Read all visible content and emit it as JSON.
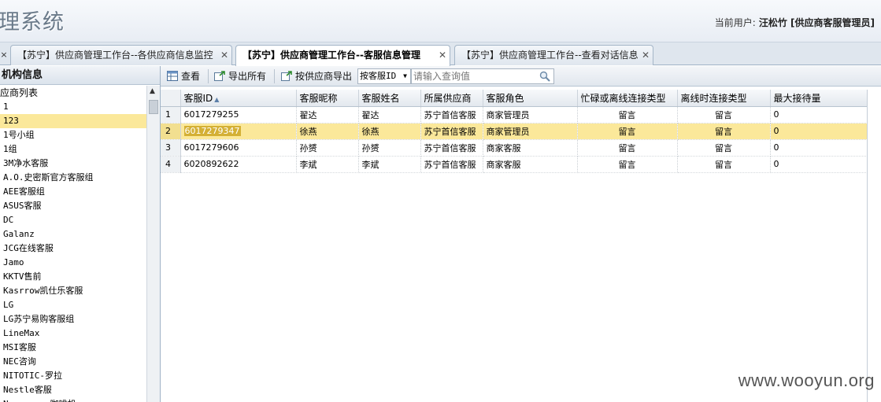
{
  "header": {
    "app_title": "理系统",
    "current_user_label": "当前用户:",
    "current_user_value": "汪松竹 [供应商客服管理员]"
  },
  "tabs": [
    {
      "label": "【苏宁】供应商管理工作台--各供应商信息监控",
      "active": false
    },
    {
      "label": "【苏宁】供应商管理工作台--客服信息管理",
      "active": true
    },
    {
      "label": "【苏宁】供应商管理工作台--查看对话信息",
      "active": false
    }
  ],
  "sidebar": {
    "title": "机构信息",
    "root": "应商列表",
    "items": [
      "1",
      "123",
      "1号小组",
      "1组",
      "3M净水客服",
      "A.O.史密斯官方客服组",
      "AEE客服组",
      "ASUS客服",
      "DC",
      "Galanz",
      "JCG在线客服",
      "Jamo",
      "KKTV售前",
      "Kasrrow凯仕乐客服",
      "LG",
      "LG苏宁易购客服组",
      "LineMax",
      "MSI客服",
      "NEC咨询",
      "NITOTIC-罗拉",
      "Nestle客服",
      "Nespresso咖啡机"
    ],
    "selected_index": 1
  },
  "toolbar": {
    "view_label": "查看",
    "export_all_label": "导出所有",
    "export_by_supplier_label": "按供应商导出",
    "select_value": "按客服ID",
    "search_placeholder": "请输入查询值"
  },
  "grid": {
    "columns": [
      "客服ID",
      "客服昵称",
      "客服姓名",
      "所属供应商",
      "客服角色",
      "忙碌或离线连接类型",
      "离线时连接类型",
      "最大接待量"
    ],
    "rows": [
      {
        "num": "1",
        "id": "6017279255",
        "nick": "翟达",
        "name": "翟达",
        "supplier": "苏宁首信客服",
        "role": "商家管理员",
        "busy": "留言",
        "offline": "留言",
        "max": "0"
      },
      {
        "num": "2",
        "id": "6017279347",
        "nick": "徐燕",
        "name": "徐燕",
        "supplier": "苏宁首信客服",
        "role": "商家管理员",
        "busy": "留言",
        "offline": "留言",
        "max": "0"
      },
      {
        "num": "3",
        "id": "6017279606",
        "nick": "孙赟",
        "name": "孙赟",
        "supplier": "苏宁首信客服",
        "role": "商家客服",
        "busy": "留言",
        "offline": "留言",
        "max": "0"
      },
      {
        "num": "4",
        "id": "6020892622",
        "nick": "李斌",
        "name": "李斌",
        "supplier": "苏宁首信客服",
        "role": "商家客服",
        "busy": "留言",
        "offline": "留言",
        "max": "0"
      }
    ],
    "selected_row": 1
  },
  "watermark": "www.wooyun.org",
  "colors": {
    "selection": "#fbe89a",
    "header_bg": "#e8edf4",
    "border": "#9fb2c6"
  }
}
